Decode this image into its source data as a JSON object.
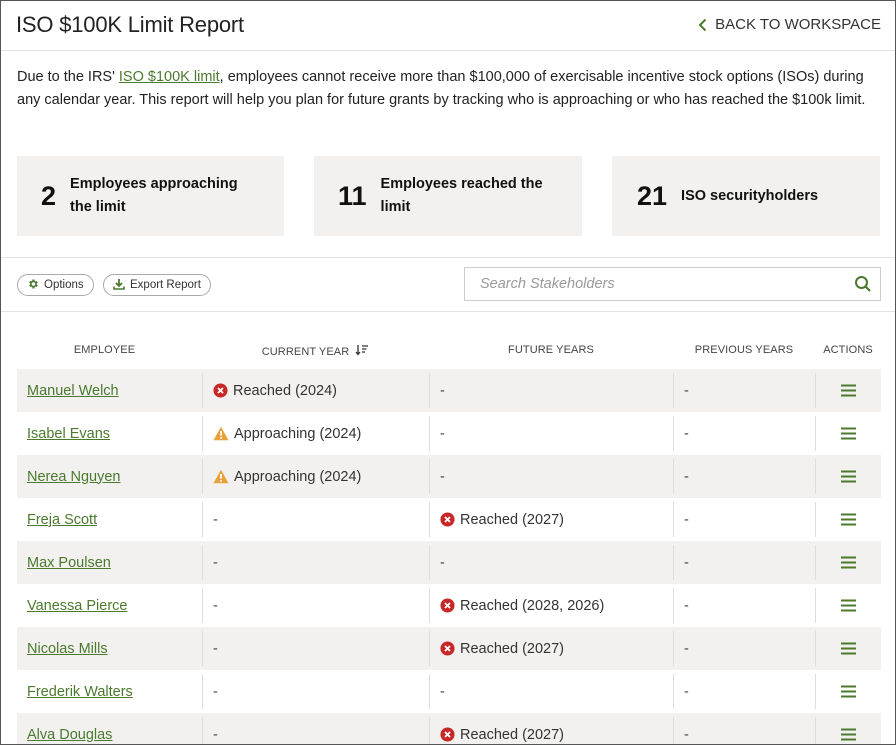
{
  "header": {
    "title": "ISO $100K Limit Report",
    "back_label": "BACK TO WORKSPACE"
  },
  "intro": {
    "prefix": "Due to the IRS' ",
    "link": "ISO $100K limit",
    "suffix": ", employees cannot receive more than $100,000 of exercisable incentive stock options (ISOs) during any calendar year. This report will help you plan for future grants by tracking who is approaching or who has reached the $100k limit."
  },
  "stats": [
    {
      "num": "2",
      "label": "Employees approaching the limit"
    },
    {
      "num": "11",
      "label": "Employees reached the limit"
    },
    {
      "num": "21",
      "label": "ISO securityholders"
    }
  ],
  "toolbar": {
    "options_label": "Options",
    "export_label": "Export Report",
    "search_placeholder": "Search Stakeholders"
  },
  "table": {
    "columns": [
      "EMPLOYEE",
      "CURRENT YEAR",
      "FUTURE YEARS",
      "PREVIOUS YEARS",
      "ACTIONS"
    ],
    "rows": [
      {
        "name": "Manuel Welch",
        "current": {
          "type": "reached",
          "text": "Reached (2024)"
        },
        "future": {
          "type": "none",
          "text": "-"
        },
        "previous": "-"
      },
      {
        "name": "Isabel Evans",
        "current": {
          "type": "approaching",
          "text": "Approaching (2024)"
        },
        "future": {
          "type": "none",
          "text": "-"
        },
        "previous": "-"
      },
      {
        "name": "Nerea Nguyen",
        "current": {
          "type": "approaching",
          "text": "Approaching (2024)"
        },
        "future": {
          "type": "none",
          "text": "-"
        },
        "previous": "-"
      },
      {
        "name": "Freja Scott",
        "current": {
          "type": "none",
          "text": "-"
        },
        "future": {
          "type": "reached",
          "text": "Reached (2027)"
        },
        "previous": "-"
      },
      {
        "name": "Max Poulsen",
        "current": {
          "type": "none",
          "text": "-"
        },
        "future": {
          "type": "none",
          "text": "-"
        },
        "previous": "-"
      },
      {
        "name": "Vanessa Pierce",
        "current": {
          "type": "none",
          "text": "-"
        },
        "future": {
          "type": "reached",
          "text": "Reached (2028, 2026)"
        },
        "previous": "-"
      },
      {
        "name": "Nicolas Mills",
        "current": {
          "type": "none",
          "text": "-"
        },
        "future": {
          "type": "reached",
          "text": "Reached (2027)"
        },
        "previous": "-"
      },
      {
        "name": "Frederik Walters",
        "current": {
          "type": "none",
          "text": "-"
        },
        "future": {
          "type": "none",
          "text": "-"
        },
        "previous": "-"
      },
      {
        "name": "Alva Douglas",
        "current": {
          "type": "none",
          "text": "-"
        },
        "future": {
          "type": "reached",
          "text": "Reached (2027)"
        },
        "previous": "-"
      }
    ]
  },
  "icons": {
    "back": "chevron-left-icon",
    "options": "gear-icon",
    "export": "download-icon",
    "search": "search-icon",
    "sort": "sort-descending-icon",
    "reached": "error-circle-icon",
    "approaching": "warning-triangle-icon",
    "actions": "hamburger-menu-icon"
  },
  "colors": {
    "accent": "#4b7a2e",
    "reached": "#c62828",
    "approaching": "#e8a13a",
    "card_bg": "#f2f1ef"
  }
}
